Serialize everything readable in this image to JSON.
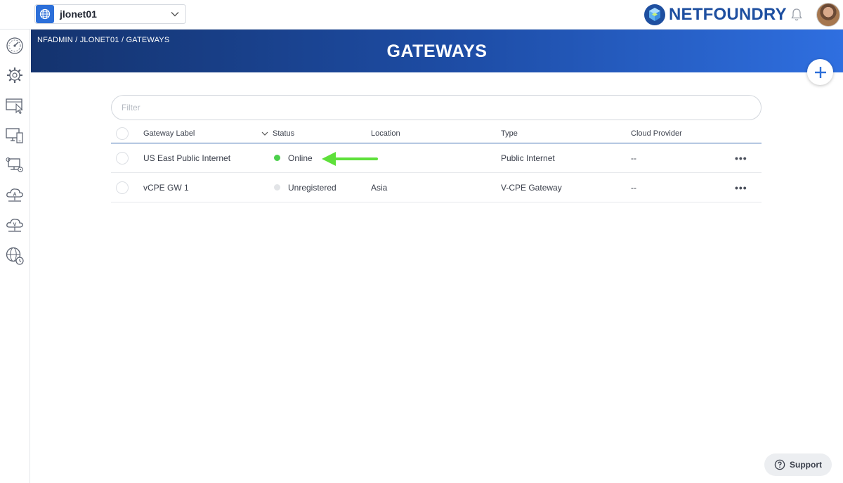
{
  "topbar": {
    "network_name": "jlonet01",
    "brand": "NETFOUNDRY",
    "icons": [
      "globe-icon",
      "chevron-down-icon",
      "bell-icon",
      "avatar"
    ]
  },
  "sidebar": {
    "items": [
      {
        "name": "dashboard-icon"
      },
      {
        "name": "settings-icon"
      },
      {
        "name": "services-icon"
      },
      {
        "name": "endpoints-icon"
      },
      {
        "name": "gateways-icon"
      },
      {
        "name": "appwans-icon"
      },
      {
        "name": "vpn-icon"
      },
      {
        "name": "network-history-icon"
      }
    ]
  },
  "header": {
    "breadcrumb": [
      "NFADMIN",
      "JLONET01",
      "GATEWAYS"
    ],
    "breadcrumb_sep": " / ",
    "title": "GATEWAYS"
  },
  "filter": {
    "placeholder": "Filter",
    "value": ""
  },
  "table": {
    "columns": [
      "Gateway Label",
      "Status",
      "Location",
      "Type",
      "Cloud Provider"
    ],
    "rows": [
      {
        "label": "US East Public Internet",
        "status": "Online",
        "status_color": "#4cd04c",
        "location": "",
        "type": "Public Internet",
        "cloud": "--",
        "menu": "•••"
      },
      {
        "label": "vCPE GW 1",
        "status": "Unregistered",
        "status_color": "#e2e4e7",
        "location": "Asia",
        "type": "V-CPE Gateway",
        "cloud": "--",
        "menu": "•••"
      }
    ]
  },
  "annotation": {
    "color": "#5ee03a"
  },
  "support": {
    "label": "Support"
  },
  "colors": {
    "accent": "#2c6fd9",
    "banner_start": "#14336e",
    "banner_end": "#2f6fe0"
  }
}
